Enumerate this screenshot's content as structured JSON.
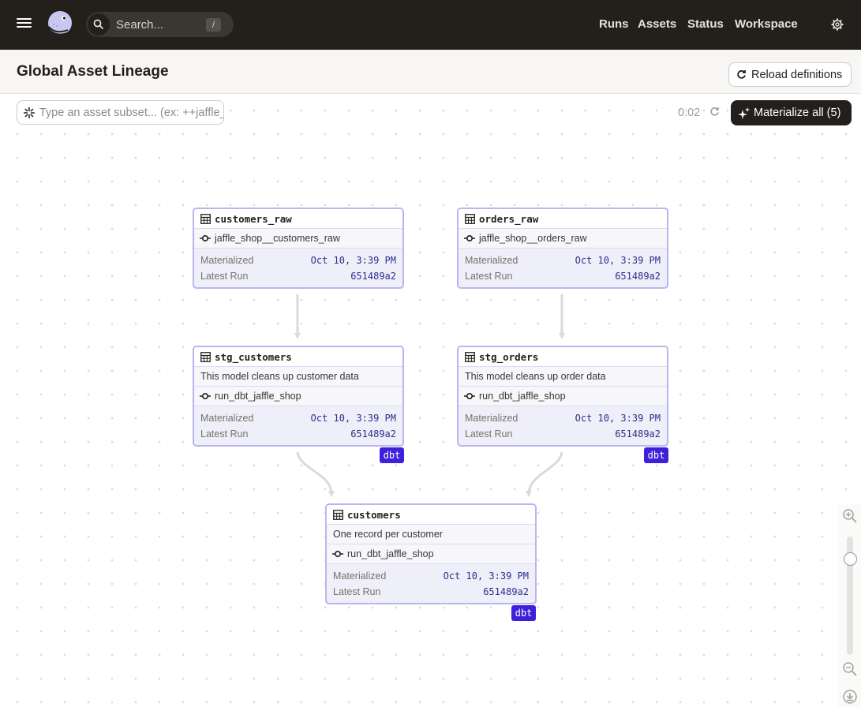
{
  "topbar": {
    "search_placeholder": "Search...",
    "search_shortcut": "/",
    "nav": [
      {
        "label": "Runs"
      },
      {
        "label": "Assets"
      },
      {
        "label": "Status"
      },
      {
        "label": "Workspace"
      }
    ],
    "icons": {
      "menu": "hamburger-icon",
      "logo": "dagster-logo",
      "search": "search-icon",
      "settings": "gear-icon"
    }
  },
  "page": {
    "title": "Global Asset Lineage",
    "reload_label": "Reload definitions"
  },
  "toolbar": {
    "subset_placeholder": "Type an asset subset... (ex: ++jaffle_shop",
    "timer": "0:02",
    "materialize_label": "Materialize all (5)"
  },
  "colors": {
    "topbar_bg": "#231f1b",
    "node_border": "#b9b6ef",
    "node_stats_bg": "#efeff9",
    "dbt_badge": "#3f1fd9",
    "value_text": "#2b2e8c"
  },
  "graph": {
    "nodes": [
      {
        "id": "customers_raw",
        "name": "customers_raw",
        "description": "",
        "op": "jaffle_shop__customers_raw",
        "materialized_label": "Materialized",
        "materialized": "Oct 10, 3:39 PM",
        "latest_run_label": "Latest Run",
        "latest_run": "651489a2",
        "badge": ""
      },
      {
        "id": "orders_raw",
        "name": "orders_raw",
        "description": "",
        "op": "jaffle_shop__orders_raw",
        "materialized_label": "Materialized",
        "materialized": "Oct 10, 3:39 PM",
        "latest_run_label": "Latest Run",
        "latest_run": "651489a2",
        "badge": ""
      },
      {
        "id": "stg_customers",
        "name": "stg_customers",
        "description": "This model cleans up customer data",
        "op": "run_dbt_jaffle_shop",
        "materialized_label": "Materialized",
        "materialized": "Oct 10, 3:39 PM",
        "latest_run_label": "Latest Run",
        "latest_run": "651489a2",
        "badge": "dbt"
      },
      {
        "id": "stg_orders",
        "name": "stg_orders",
        "description": "This model cleans up order data",
        "op": "run_dbt_jaffle_shop",
        "materialized_label": "Materialized",
        "materialized": "Oct 10, 3:39 PM",
        "latest_run_label": "Latest Run",
        "latest_run": "651489a2",
        "badge": "dbt"
      },
      {
        "id": "customers",
        "name": "customers",
        "description": "One record per customer",
        "op": "run_dbt_jaffle_shop",
        "materialized_label": "Materialized",
        "materialized": "Oct 10, 3:39 PM",
        "latest_run_label": "Latest Run",
        "latest_run": "651489a2",
        "badge": "dbt"
      }
    ],
    "edges": [
      {
        "from": "customers_raw",
        "to": "stg_customers"
      },
      {
        "from": "orders_raw",
        "to": "stg_orders"
      },
      {
        "from": "stg_customers",
        "to": "customers"
      },
      {
        "from": "stg_orders",
        "to": "customers"
      }
    ],
    "zoom_level": 0.85
  }
}
